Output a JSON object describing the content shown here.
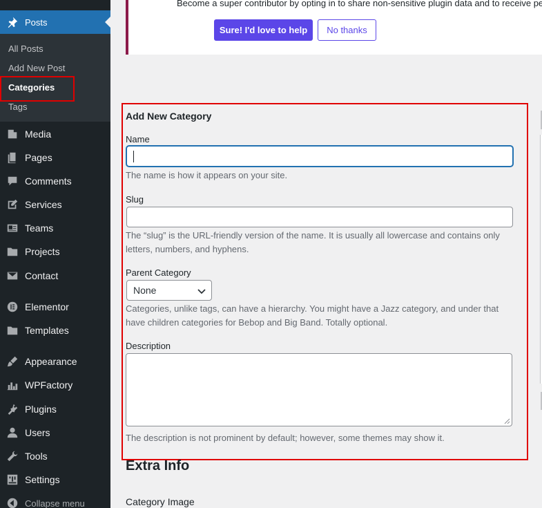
{
  "sidebar": {
    "posts_label": "Posts",
    "submenu": [
      {
        "label": "All Posts"
      },
      {
        "label": "Add New Post"
      },
      {
        "label": "Categories"
      },
      {
        "label": "Tags"
      }
    ],
    "menu": [
      {
        "label": "Media",
        "icon": "media-icon"
      },
      {
        "label": "Pages",
        "icon": "pages-icon"
      },
      {
        "label": "Comments",
        "icon": "comments-icon"
      },
      {
        "label": "Services",
        "icon": "services-icon"
      },
      {
        "label": "Teams",
        "icon": "teams-icon"
      },
      {
        "label": "Projects",
        "icon": "projects-icon"
      },
      {
        "label": "Contact",
        "icon": "envelope-icon"
      },
      {
        "label": "Elementor",
        "icon": "elementor-icon"
      },
      {
        "label": "Templates",
        "icon": "folder-icon"
      },
      {
        "label": "Appearance",
        "icon": "paintbrush-icon"
      },
      {
        "label": "WPFactory",
        "icon": "chart-icon"
      },
      {
        "label": "Plugins",
        "icon": "plug-icon"
      },
      {
        "label": "Users",
        "icon": "user-icon"
      },
      {
        "label": "Tools",
        "icon": "wrench-icon"
      },
      {
        "label": "Settings",
        "icon": "sliders-icon"
      }
    ],
    "collapse_label": "Collapse menu"
  },
  "notice": {
    "text": "Become a super contributor by opting in to share non-sensitive plugin data and to receive pe",
    "accept_label": "Sure! I'd love to help",
    "decline_label": "No thanks"
  },
  "form": {
    "title": "Add New Category",
    "name_label": "Name",
    "name_value": "",
    "name_help": "The name is how it appears on your site.",
    "slug_label": "Slug",
    "slug_value": "",
    "slug_help": "The “slug” is the URL-friendly version of the name. It is usually all lowercase and contains only letters, numbers, and hyphens.",
    "parent_label": "Parent Category",
    "parent_value": "None",
    "parent_help": "Categories, unlike tags, can have a hierarchy. You might have a Jazz category, and under that have children categories for Bebop and Big Band. Totally optional.",
    "description_label": "Description",
    "description_value": "",
    "description_help": "The description is not prominent by default; however, some themes may show it."
  },
  "extra": {
    "title": "Extra Info",
    "category_image_label": "Category Image"
  },
  "colors": {
    "sidebar_bg": "#1d2327",
    "active_blue": "#2271b1",
    "highlight_red": "#e00000",
    "button_purple": "#5b46e8"
  }
}
